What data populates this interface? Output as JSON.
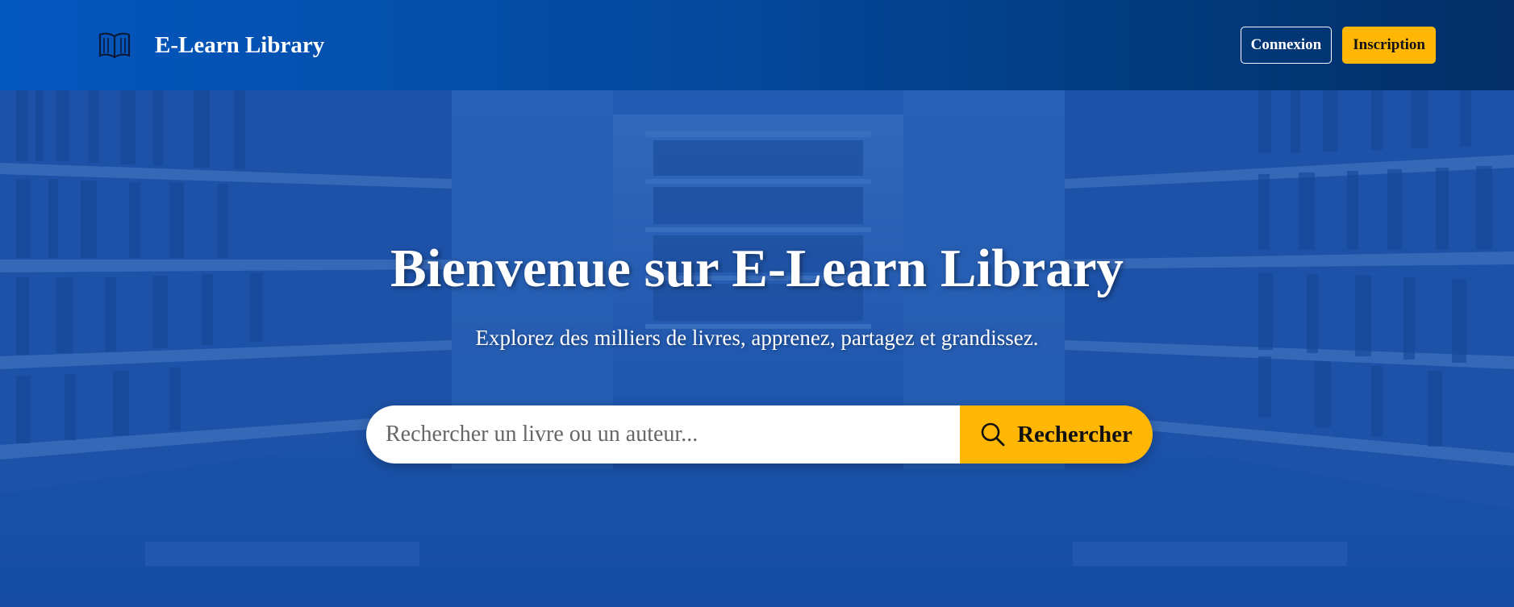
{
  "header": {
    "brand_icon": "open-book-icon",
    "brand_name": "E-Learn Library",
    "login_label": "Connexion",
    "signup_label": "Inscription"
  },
  "hero": {
    "title": "Bienvenue sur E-Learn Library",
    "subtitle": "Explorez des milliers de livres, apprenez, partagez et grandissez.",
    "search": {
      "placeholder": "Rechercher un livre ou un auteur...",
      "value": "",
      "button_label": "Rechercher",
      "button_icon": "search-icon"
    },
    "background": "library-bookshelves-photo"
  },
  "colors": {
    "nav_start": "#0457bf",
    "nav_end": "#022f66",
    "accent": "#ffb703",
    "hero_overlay": "#104caa"
  }
}
